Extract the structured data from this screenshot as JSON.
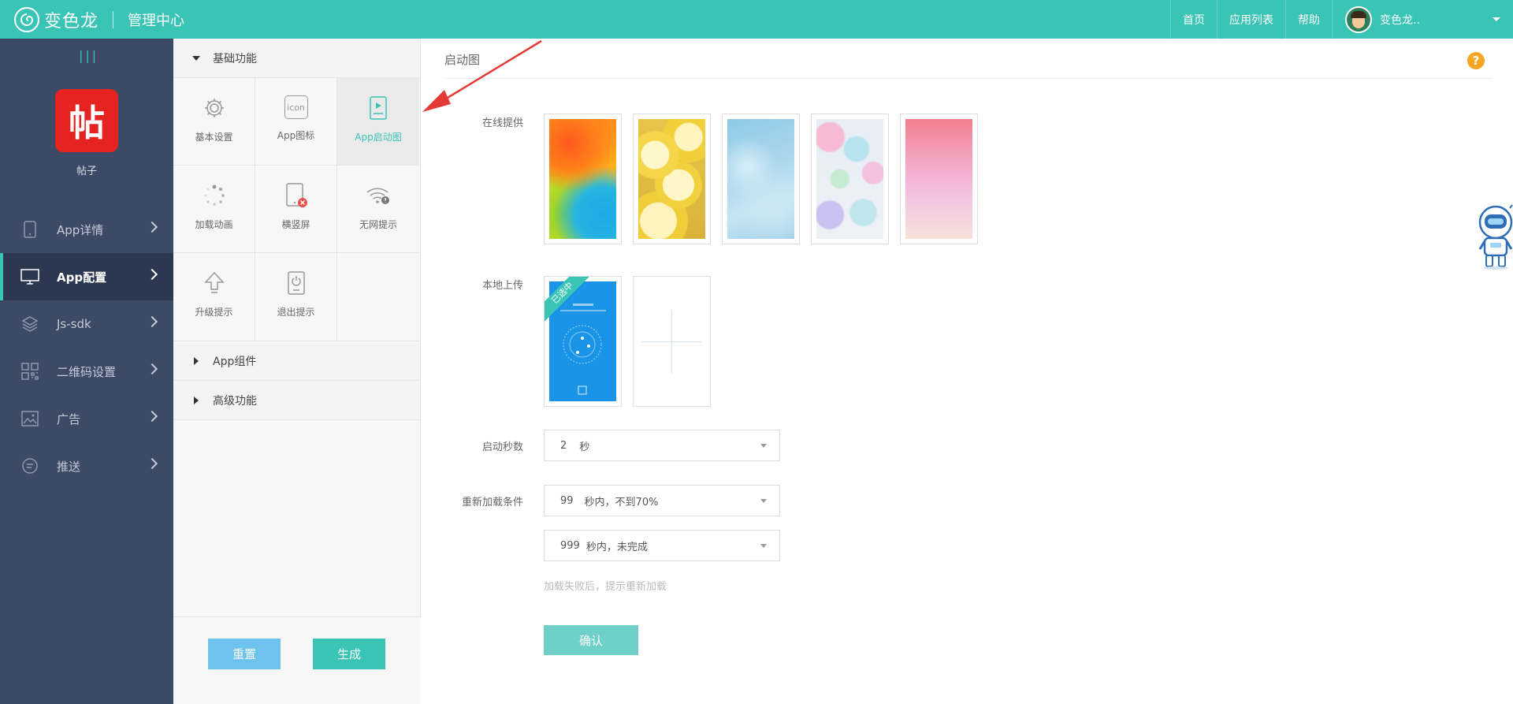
{
  "topbar": {
    "brand_name": "变色龙",
    "brand_sub": "管理中心",
    "nav": [
      "首页",
      "应用列表",
      "帮助"
    ],
    "user_name": "变色龙.."
  },
  "sidebar": {
    "collapse_label": "|||",
    "app_logo_char": "帖",
    "app_name": "帖子",
    "items": [
      {
        "label": "App详情",
        "icon": "phone-icon"
      },
      {
        "label": "App配置",
        "icon": "monitor-icon"
      },
      {
        "label": "Js-sdk",
        "icon": "layers-icon"
      },
      {
        "label": "二维码设置",
        "icon": "qrcode-icon"
      },
      {
        "label": "广告",
        "icon": "image-icon"
      },
      {
        "label": "推送",
        "icon": "chat-icon"
      }
    ]
  },
  "panel": {
    "group_basic": "基础功能",
    "tiles": [
      {
        "label": "基本设置",
        "icon": "gear-icon"
      },
      {
        "label": "App图标",
        "icon": "app-icon-icon",
        "glyph": "icon"
      },
      {
        "label": "App启动图",
        "icon": "launch-screen-icon"
      },
      {
        "label": "加载动画",
        "icon": "loading-icon"
      },
      {
        "label": "横竖屏",
        "icon": "rotate-screen-icon"
      },
      {
        "label": "无网提示",
        "icon": "wifi-off-icon"
      },
      {
        "label": "升级提示",
        "icon": "upgrade-icon"
      },
      {
        "label": "退出提示",
        "icon": "exit-icon"
      }
    ],
    "group_components": "App组件",
    "group_advanced": "高级功能",
    "reset_label": "重置",
    "generate_label": "生成"
  },
  "main": {
    "title": "启动图",
    "help_glyph": "?",
    "online_label": "在线提供",
    "local_label": "本地上传",
    "selected_badge": "已选中",
    "duration_label": "启动秒数",
    "duration_value": "2",
    "duration_unit": "秒",
    "reload_label": "重新加载条件",
    "reload1_value": "99",
    "reload1_unit": "秒内，不到70%",
    "reload2_value": "999",
    "reload2_unit": "秒内，未完成",
    "hint": "加载失败后，提示重新加载",
    "confirm_label": "确认"
  },
  "colors": {
    "accent": "#39c4b6",
    "sidebar_bg": "#3c4a66",
    "logo_red": "#e52421",
    "reset_blue": "#6ec3ee",
    "confirm": "#6fd0c9",
    "help_orange": "#f5a623"
  }
}
